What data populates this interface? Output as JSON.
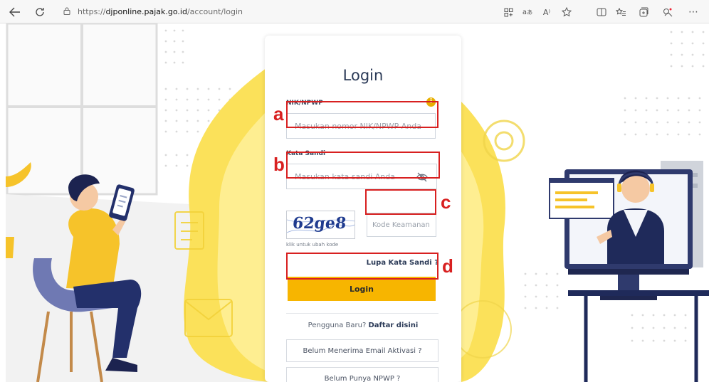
{
  "browser": {
    "url_prefix": "https://",
    "url_host": "djponline.pajak.go.id",
    "url_path": "/account/login",
    "read_aloud_label": "A⁾"
  },
  "card": {
    "title": "Login",
    "nik_label": "NIK/NPWP",
    "nik_placeholder": "Masukan nomor NIK/NPWP Anda",
    "password_label": "Kata Sandi",
    "password_placeholder": "Masukan kata sandi Anda",
    "captcha_text": "62ge8",
    "captcha_hint": "klik untuk ubah kode",
    "security_placeholder": "Kode Keamanan",
    "forgot_password": "Lupa Kata Sandi ?",
    "login_button": "Login",
    "new_user_text": "Pengguna Baru?",
    "register_link": "Daftar disini",
    "activation_email_button": "Belum Menerima Email Aktivasi ?",
    "no_npwp_button": "Belum Punya NPWP ?"
  },
  "annotations": {
    "a": "a",
    "b": "b",
    "c": "c",
    "d": "d",
    "color": "#d82020"
  },
  "colors": {
    "accent": "#f7b500",
    "title": "#2b3a57"
  }
}
